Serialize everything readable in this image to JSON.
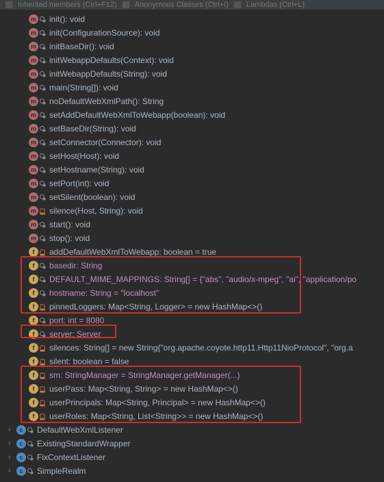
{
  "toolbar": {
    "items": [
      {
        "label": "Inherited members (Ctrl+F12)"
      },
      {
        "label": "Anonymous Classes (Ctrl+I)"
      },
      {
        "label": "Lambdas (Ctrl+L)"
      }
    ]
  },
  "method_items": [
    {
      "vis": "key",
      "purple": false,
      "label": "init(): void"
    },
    {
      "vis": "key",
      "purple": false,
      "label": "init(ConfigurationSource): void"
    },
    {
      "vis": "key",
      "purple": false,
      "label": "initBaseDir(): void"
    },
    {
      "vis": "key",
      "purple": false,
      "label": "initWebappDefaults(Context): void"
    },
    {
      "vis": "key",
      "purple": false,
      "label": "initWebappDefaults(String): void"
    },
    {
      "vis": "key",
      "purple": false,
      "label": "main(String[]): void"
    },
    {
      "vis": "key",
      "purple": false,
      "label": "noDefaultWebXmlPath(): String"
    },
    {
      "vis": "key",
      "purple": false,
      "label": "setAddDefaultWebXmlToWebapp(boolean): void"
    },
    {
      "vis": "key",
      "purple": false,
      "label": "setBaseDir(String): void"
    },
    {
      "vis": "key",
      "purple": false,
      "label": "setConnector(Connector): void"
    },
    {
      "vis": "key",
      "purple": false,
      "label": "setHost(Host): void"
    },
    {
      "vis": "key",
      "purple": false,
      "label": "setHostname(String): void"
    },
    {
      "vis": "key",
      "purple": false,
      "label": "setPort(int): void"
    },
    {
      "vis": "key",
      "purple": false,
      "label": "setSilent(boolean): void"
    },
    {
      "vis": "lock",
      "purple": false,
      "label": "silence(Host, String): void"
    },
    {
      "vis": "key",
      "purple": false,
      "label": "start(): void"
    },
    {
      "vis": "key",
      "purple": false,
      "label": "stop(): void"
    }
  ],
  "field_items": [
    {
      "vis": "lock",
      "purple": false,
      "label": "addDefaultWebXmlToWebapp: boolean = true"
    },
    {
      "vis": "key",
      "purple": true,
      "label": "basedir: String"
    },
    {
      "vis": "key",
      "purple": true,
      "label": "DEFAULT_MIME_MAPPINGS: String[] = {\"abs\", \"audio/x-mpeg\", \"ai\", \"application/po"
    },
    {
      "vis": "key",
      "purple": true,
      "label": "hostname: String = \"localhost\""
    },
    {
      "vis": "lock",
      "purple": false,
      "label": "pinnedLoggers: Map<String, Logger> = new HashMap<>()"
    },
    {
      "vis": "key",
      "purple": true,
      "label": "port: int = 8080"
    },
    {
      "vis": "key",
      "purple": true,
      "label": "server: Server"
    },
    {
      "vis": "lock",
      "purple": false,
      "label": "silences: String[] = new String{\"org.apache.coyote.http11.Http11NioProtocol\", \"org.a"
    },
    {
      "vis": "lock",
      "purple": false,
      "label": "silent: boolean = false"
    },
    {
      "vis": "lock",
      "purple": true,
      "label": "sm: StringManager = StringManager.getManager(...)"
    },
    {
      "vis": "lock",
      "purple": false,
      "label": "userPass: Map<String, String> = new HashMap<>()"
    },
    {
      "vis": "lock",
      "purple": false,
      "label": "userPrincipals: Map<String, Principal> = new HashMap<>()"
    },
    {
      "vis": "lock",
      "purple": false,
      "label": "userRoles: Map<String, List<String>> = new HashMap<>()"
    }
  ],
  "class_items": [
    {
      "label": "DefaultWebXmlListener"
    },
    {
      "label": "ExistingStandardWrapper"
    },
    {
      "label": "FixContextListener"
    },
    {
      "label": "SimpleRealm"
    }
  ]
}
